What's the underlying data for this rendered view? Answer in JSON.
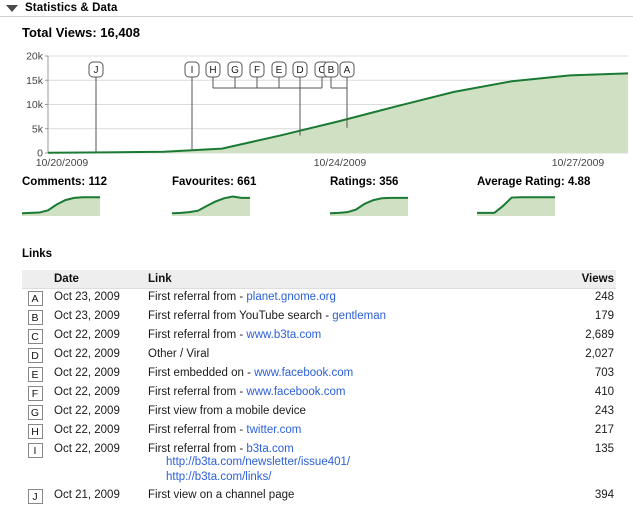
{
  "header": {
    "title": "Statistics & Data",
    "toggle_icon": "triangle-down-icon"
  },
  "total_views_label": "Total Views: 16,408",
  "chart_data": {
    "type": "area",
    "title": "Total Views: 16,408",
    "xlabel": "",
    "ylabel": "",
    "ylim": [
      0,
      20000
    ],
    "ytick_labels": [
      "20k",
      "15k",
      "10k",
      "5k",
      "0"
    ],
    "ytick_values": [
      20000,
      15000,
      10000,
      5000,
      0
    ],
    "xtick_labels": [
      "10/20/2009",
      "10/24/2009",
      "10/27/2009"
    ],
    "grid": true,
    "line_color": "#1a7a33",
    "fill_color": "#cfe0c3",
    "x": [
      "10/19/2009",
      "10/20/2009",
      "10/21/2009",
      "10/22/2009",
      "10/23/2009",
      "10/24/2009",
      "10/25/2009",
      "10/26/2009",
      "10/27/2009",
      "10/28/2009"
    ],
    "values": [
      60,
      120,
      260,
      900,
      3600,
      6500,
      9600,
      12600,
      14800,
      16000,
      16408
    ],
    "annotations": [
      {
        "label": "J",
        "x_date": "10/21/2009",
        "y": 200
      },
      {
        "label": "I",
        "x_date": "10/22/2009",
        "y": 450
      },
      {
        "label": "H",
        "x_date": "10/22/2009",
        "y": 450
      },
      {
        "label": "G",
        "x_date": "10/22/2009",
        "y": 450
      },
      {
        "label": "F",
        "x_date": "10/22/2009",
        "y": 450
      },
      {
        "label": "E",
        "x_date": "10/22/2009",
        "y": 450
      },
      {
        "label": "D",
        "x_date": "10/22/2009",
        "y": 3600
      },
      {
        "label": "C",
        "x_date": "10/22/2009",
        "y": 3600
      },
      {
        "label": "B",
        "x_date": "10/23/2009",
        "y": 5200
      },
      {
        "label": "A",
        "x_date": "10/23/2009",
        "y": 5200
      }
    ]
  },
  "mini_stats": [
    {
      "label": "Comments: 112",
      "name": "comments",
      "spark": {
        "type": "area",
        "values": [
          2,
          3,
          4,
          10,
          26,
          38,
          44,
          46,
          46,
          46
        ]
      }
    },
    {
      "label": "Favourites: 661",
      "name": "favourites",
      "spark": {
        "type": "area",
        "values": [
          2,
          3,
          5,
          9,
          22,
          34,
          43,
          48,
          44,
          44
        ]
      }
    },
    {
      "label": "Ratings: 356",
      "name": "ratings",
      "spark": {
        "type": "area",
        "values": [
          2,
          3,
          5,
          12,
          28,
          38,
          43,
          44,
          44,
          44
        ]
      }
    },
    {
      "label": "Average Rating: 4.88",
      "name": "average-rating",
      "spark": {
        "type": "area",
        "values": [
          3,
          3,
          3,
          22,
          45,
          46,
          46,
          46,
          46,
          46
        ]
      }
    }
  ],
  "links": {
    "section_label": "Links",
    "columns": {
      "badge": "",
      "date": "Date",
      "link": "Link",
      "views": "Views"
    },
    "rows": [
      {
        "badge": "A",
        "date": "Oct 23, 2009",
        "prefix": "First referral from - ",
        "link_text": "planet.gnome.org",
        "views": "248",
        "sublinks": []
      },
      {
        "badge": "B",
        "date": "Oct 23, 2009",
        "prefix": "First referral from YouTube search - ",
        "link_text": "gentleman",
        "views": "179",
        "sublinks": []
      },
      {
        "badge": "C",
        "date": "Oct 22, 2009",
        "prefix": "First referral from - ",
        "link_text": "www.b3ta.com",
        "views": "2,689",
        "sublinks": []
      },
      {
        "badge": "D",
        "date": "Oct 22, 2009",
        "prefix": "Other / Viral",
        "link_text": "",
        "views": "2,027",
        "sublinks": []
      },
      {
        "badge": "E",
        "date": "Oct 22, 2009",
        "prefix": "First embedded on - ",
        "link_text": "www.facebook.com",
        "views": "703",
        "sublinks": []
      },
      {
        "badge": "F",
        "date": "Oct 22, 2009",
        "prefix": "First referral from - ",
        "link_text": "www.facebook.com",
        "views": "410",
        "sublinks": []
      },
      {
        "badge": "G",
        "date": "Oct 22, 2009",
        "prefix": "First view from a mobile device",
        "link_text": "",
        "views": "243",
        "sublinks": []
      },
      {
        "badge": "H",
        "date": "Oct 22, 2009",
        "prefix": "First referral from - ",
        "link_text": "twitter.com",
        "views": "217",
        "sublinks": []
      },
      {
        "badge": "I",
        "date": "Oct 22, 2009",
        "prefix": "First referral from - ",
        "link_text": "b3ta.com",
        "views": "135",
        "sublinks": [
          "http://b3ta.com/newsletter/issue401/",
          "http://b3ta.com/links/"
        ]
      },
      {
        "badge": "J",
        "date": "Oct 21, 2009",
        "prefix": "First view on a channel page",
        "link_text": "",
        "views": "394",
        "sublinks": []
      }
    ]
  },
  "colors": {
    "line": "#1a7a33",
    "fill": "#cfe0c3",
    "link": "#2b5fd9",
    "grid": "#dcdcdc",
    "header_bg": "#eeeeee"
  }
}
